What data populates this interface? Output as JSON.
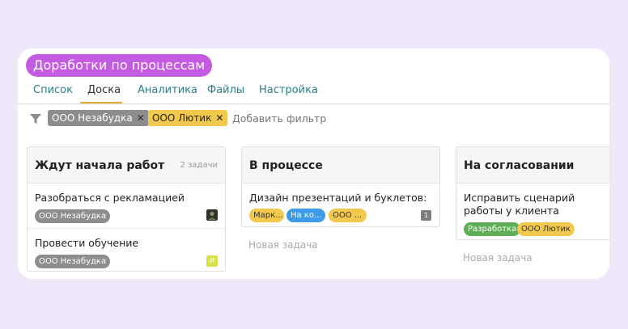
{
  "header": {
    "title": "Доработки по процессам"
  },
  "tabs": [
    {
      "label": "Список"
    },
    {
      "label": "Доска"
    },
    {
      "label": "Аналитика"
    },
    {
      "label": "Файлы"
    },
    {
      "label": "Настройка"
    }
  ],
  "active_tab": "Доска",
  "filters": {
    "chips": [
      {
        "label": "ООО Незабудка",
        "close": "✕"
      },
      {
        "label": "ООО Лютик",
        "close": "✕"
      }
    ],
    "add_label": "Добавить фильтр"
  },
  "columns": [
    {
      "title": "Ждут начала работ",
      "count": "2 задачи",
      "cards": [
        {
          "title": "Разобраться с рекламацией",
          "tags": [
            {
              "label": "ООО Незабудка",
              "color": "#8d8d8d"
            }
          ],
          "avatar": "photo-avatar"
        },
        {
          "title": "Провести обучение",
          "tags": [
            {
              "label": "ООО Незабудка",
              "color": "#8d8d8d"
            }
          ],
          "avatar_letter": "И",
          "avatar_color": "#d9e04a"
        }
      ]
    },
    {
      "title": "В процессе",
      "cards": [
        {
          "title": "Дизайн презентаций и буклетов:",
          "tags": [
            {
              "label": "Марк...",
              "color": "#f2c94c"
            },
            {
              "label": "На ко...",
              "color": "#3d9be9"
            },
            {
              "label": "ООО ...",
              "color": "#f2c94c"
            }
          ],
          "badge": "1"
        }
      ],
      "new_task": "Новая задача"
    },
    {
      "title": "На согласовании",
      "cards": [
        {
          "title": "Исправить сценарий работы у клиента",
          "tags": [
            {
              "label": "Разработка",
              "color": "#5fae57"
            },
            {
              "label": "ООО Лютик",
              "color": "#f2c94c"
            }
          ]
        }
      ],
      "new_task": "Новая задача"
    }
  ]
}
